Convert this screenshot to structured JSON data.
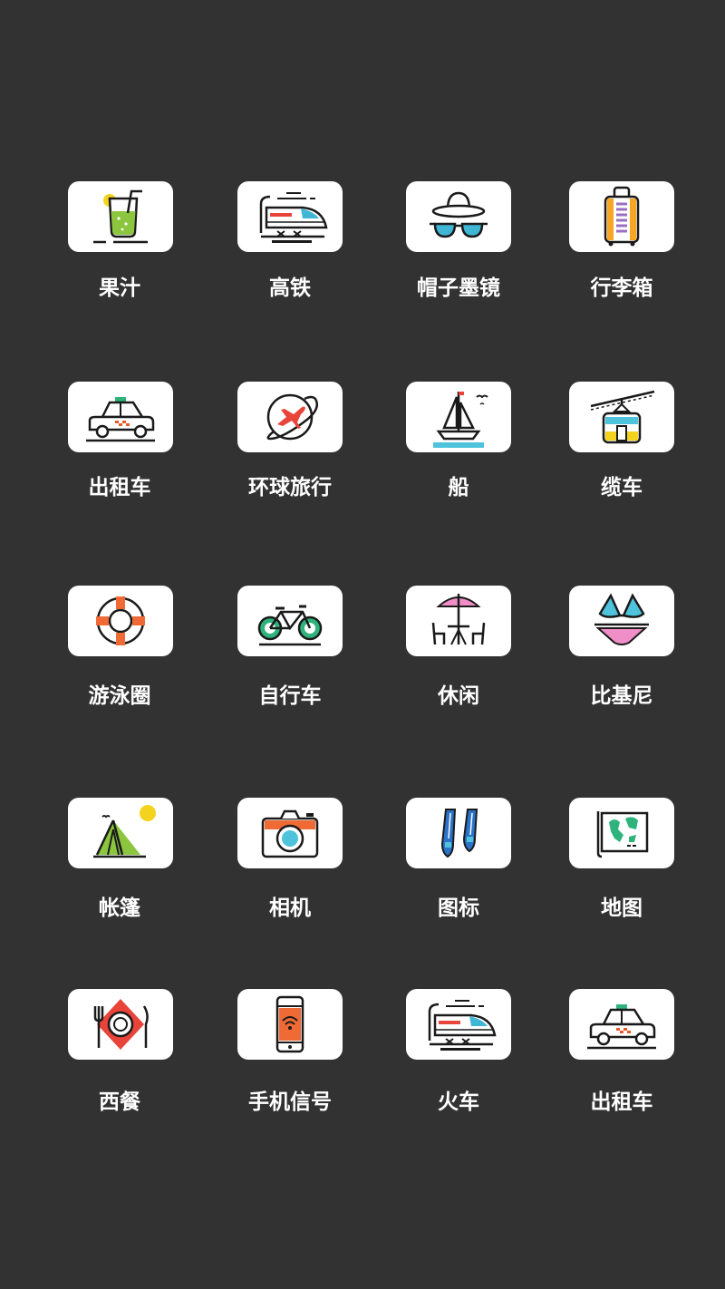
{
  "colors": {
    "background": "#323232",
    "tile": "#ffffff",
    "label": "#ffffff"
  },
  "items": [
    {
      "label": "果汁",
      "icon": "juice-icon"
    },
    {
      "label": "高铁",
      "icon": "high-speed-train-icon"
    },
    {
      "label": "帽子墨镜",
      "icon": "hat-sunglasses-icon"
    },
    {
      "label": "行李箱",
      "icon": "suitcase-icon"
    },
    {
      "label": "出租车",
      "icon": "taxi-icon"
    },
    {
      "label": "环球旅行",
      "icon": "globe-travel-icon"
    },
    {
      "label": "船",
      "icon": "sailboat-icon"
    },
    {
      "label": "缆车",
      "icon": "cable-car-icon"
    },
    {
      "label": "游泳圈",
      "icon": "lifebuoy-icon"
    },
    {
      "label": "自行车",
      "icon": "bicycle-icon"
    },
    {
      "label": "休闲",
      "icon": "leisure-table-icon"
    },
    {
      "label": "比基尼",
      "icon": "bikini-icon"
    },
    {
      "label": "帐篷",
      "icon": "tent-icon"
    },
    {
      "label": "相机",
      "icon": "camera-icon"
    },
    {
      "label": "图标",
      "icon": "swim-fins-icon"
    },
    {
      "label": "地图",
      "icon": "map-icon"
    },
    {
      "label": "西餐",
      "icon": "western-dining-icon"
    },
    {
      "label": "手机信号",
      "icon": "phone-wifi-icon"
    },
    {
      "label": "火车",
      "icon": "train-icon"
    },
    {
      "label": "出租车",
      "icon": "taxi-icon"
    }
  ]
}
